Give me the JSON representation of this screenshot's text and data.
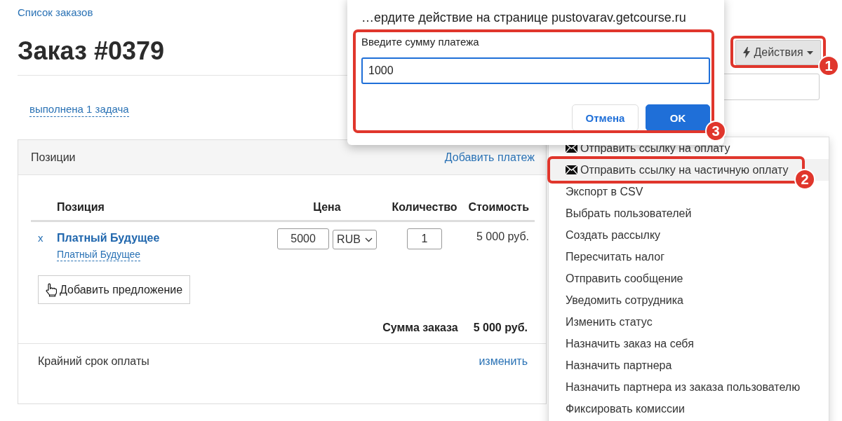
{
  "breadcrumb": "Список заказов",
  "title": "Заказ #0379",
  "tasks_link": "выполнена 1 задача",
  "actions_button": {
    "label": "Действия",
    "annotation": "1"
  },
  "positions_panel": {
    "title": "Позиции",
    "add_payment": "Добавить платеж",
    "columns": [
      "Позиция",
      "Цена",
      "Количество",
      "Стоимость"
    ],
    "rows": [
      {
        "remove": "x",
        "name": "Платный Будущее",
        "offer_link": "Платный Будущее",
        "price": "5000",
        "currency": "RUB",
        "quantity": "1",
        "cost": "5 000 руб."
      }
    ],
    "add_offer_button": "Добавить предложение",
    "total_label": "Сумма заказа",
    "total_value": "5 000 руб.",
    "due_label": "Крайний срок оплаты",
    "due_action": "изменить"
  },
  "actions_menu": {
    "items": [
      {
        "label": "Отправить ссылку на оплату",
        "kind": "mail",
        "selected": false
      },
      {
        "label": "Отправить ссылку на частичную оплату",
        "kind": "mail",
        "selected": true,
        "annotation": "2"
      },
      {
        "label": "Экспорт в CSV",
        "kind": "plain",
        "selected": false
      },
      {
        "label": "Выбрать пользователей",
        "kind": "plain",
        "selected": false
      },
      {
        "label": "Создать рассылку",
        "kind": "plain",
        "selected": false
      },
      {
        "label": "Пересчитать налог",
        "kind": "plain",
        "selected": false
      },
      {
        "label": "Отправить сообщение",
        "kind": "plain",
        "selected": false
      },
      {
        "label": "Уведомить сотрудника",
        "kind": "plain",
        "selected": false
      },
      {
        "label": "Изменить статус",
        "kind": "plain",
        "selected": false
      },
      {
        "label": "Назначить заказ на себя",
        "kind": "plain",
        "selected": false
      },
      {
        "label": "Назначить партнера",
        "kind": "plain",
        "selected": false
      },
      {
        "label": "Назначить партнера из заказа пользователю",
        "kind": "plain",
        "selected": false
      },
      {
        "label": "Фиксировать комиссии",
        "kind": "plain",
        "selected": false
      }
    ]
  },
  "dialog": {
    "title": "…ердите действие на странице pustovarav.getcourse.ru",
    "label": "Введите сумму платежа",
    "value": "1000",
    "annotation": "3",
    "buttons": [
      {
        "label": "Отмена",
        "kind": "secondary"
      },
      {
        "label": "OK",
        "kind": "primary"
      }
    ]
  }
}
